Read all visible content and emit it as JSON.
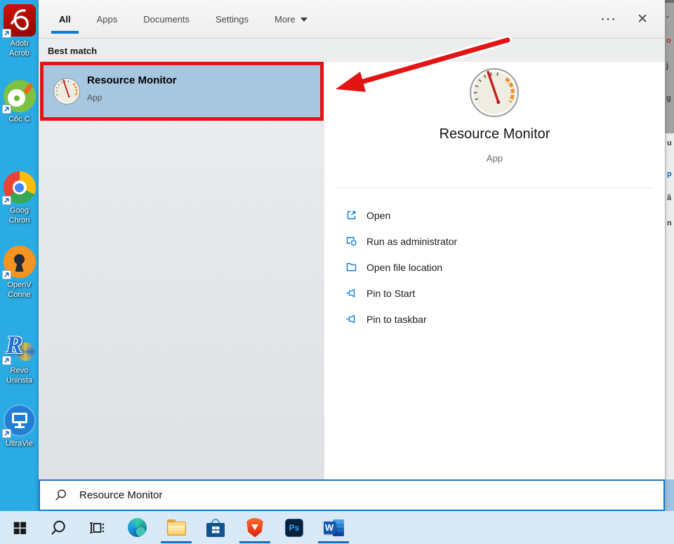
{
  "header": {
    "tabs": [
      {
        "label": "All",
        "active": true
      },
      {
        "label": "Apps",
        "active": false
      },
      {
        "label": "Documents",
        "active": false
      },
      {
        "label": "Settings",
        "active": false
      },
      {
        "label": "More",
        "active": false,
        "has_dropdown": true
      }
    ],
    "more_options": "···",
    "close": "✕"
  },
  "results": {
    "section_label": "Best match",
    "best_match": {
      "title": "Resource Monitor",
      "subtitle": "App"
    }
  },
  "preview": {
    "title": "Resource Monitor",
    "subtitle": "App",
    "actions": [
      {
        "icon": "open-icon",
        "label": "Open"
      },
      {
        "icon": "admin-shield-icon",
        "label": "Run as administrator"
      },
      {
        "icon": "file-location-icon",
        "label": "Open file location"
      },
      {
        "icon": "pin-icon",
        "label": "Pin to Start"
      },
      {
        "icon": "pin-icon",
        "label": "Pin to taskbar"
      }
    ]
  },
  "search": {
    "value": "Resource Monitor"
  },
  "desktop": {
    "icons": [
      {
        "name": "adobe-acrobat",
        "label_lines": [
          "Adob",
          "Acrob"
        ]
      },
      {
        "name": "coc-coc",
        "label_lines": [
          "Cốc C"
        ]
      },
      {
        "name": "google-chrome",
        "label_lines": [
          "Goog",
          "Chron"
        ]
      },
      {
        "name": "openvpn-connect",
        "label_lines": [
          "OpenV",
          "Conne"
        ]
      },
      {
        "name": "revo-uninstaller",
        "label_lines": [
          "Revo",
          "Uninsta"
        ],
        "letter": "R"
      },
      {
        "name": "ultraviewer",
        "label_lines": [
          "UltraVie"
        ]
      }
    ]
  },
  "taskbar": {
    "items": [
      {
        "name": "start"
      },
      {
        "name": "search"
      },
      {
        "name": "task-view"
      },
      {
        "name": "edge"
      },
      {
        "name": "file-explorer",
        "active": true
      },
      {
        "name": "microsoft-store"
      },
      {
        "name": "brave",
        "active": true
      },
      {
        "name": "photoshop",
        "label": "Ps"
      },
      {
        "name": "word",
        "label": "W",
        "active": true
      }
    ]
  },
  "background_strip": {
    "fragments": [
      "-",
      "o",
      "j",
      "g",
      "u",
      "p",
      "ã",
      "n"
    ]
  },
  "annotation": {
    "type": "highlight-box-with-arrow",
    "target": "best-match-item",
    "color": "#e41414"
  },
  "colors": {
    "accent_blue": "#0f7ad1",
    "selection_highlight": "#a7c6e0",
    "annotation_red": "#e41414",
    "desktop_background": "#2aabe3",
    "taskbar_background": "#d9e9f7",
    "panel_background": "#eceded",
    "preview_background": "#ffffff"
  }
}
